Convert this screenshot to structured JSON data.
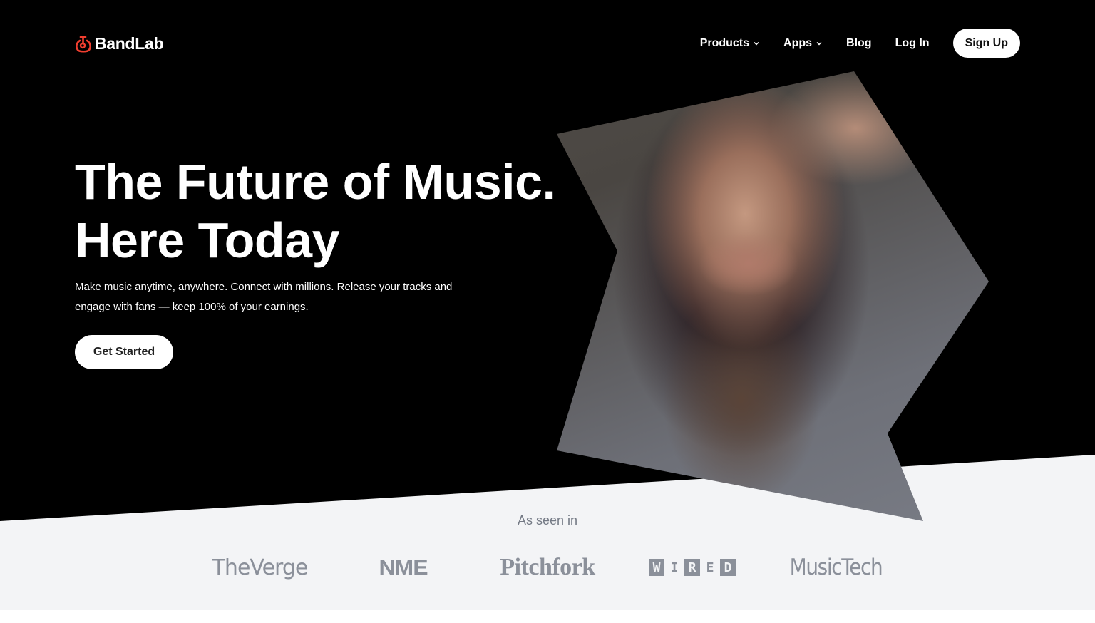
{
  "brand": {
    "name": "BandLab",
    "accent": "#f03e2f"
  },
  "nav": {
    "items": [
      {
        "label": "Products",
        "has_dropdown": true
      },
      {
        "label": "Apps",
        "has_dropdown": true
      },
      {
        "label": "Blog",
        "has_dropdown": false
      },
      {
        "label": "Log In",
        "has_dropdown": false
      }
    ],
    "signup_label": "Sign Up"
  },
  "hero": {
    "headline_line1": "The Future of Music.",
    "headline_line2": "Here Today",
    "subtitle": "Make music anytime, anywhere. Connect with millions. Release your tracks and engage with fans — keep 100% of your earnings.",
    "cta_label": "Get Started",
    "image_alt": "Portrait of a musician with long dark hair and neck tattoos wearing a denim jacket"
  },
  "press": {
    "heading": "As seen in",
    "logos": [
      {
        "name": "The Verge",
        "text": "TheVerge"
      },
      {
        "name": "NME",
        "text": "NME"
      },
      {
        "name": "Pitchfork",
        "text": "Pitchfork"
      },
      {
        "name": "WIRED",
        "letters": [
          "W",
          "I",
          "R",
          "E",
          "D"
        ]
      },
      {
        "name": "MusicTech",
        "text": "MusicTech"
      }
    ]
  }
}
